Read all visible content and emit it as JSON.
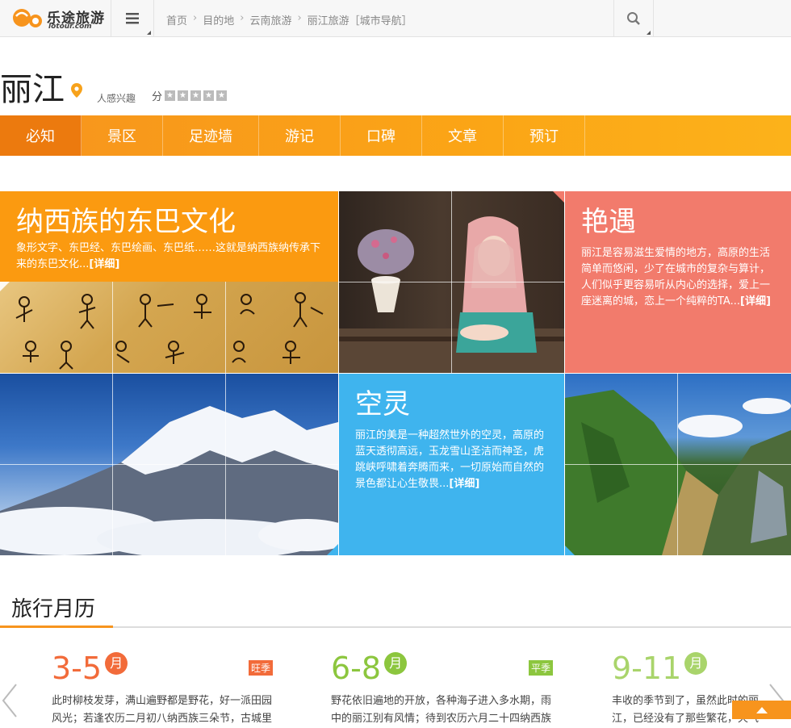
{
  "header": {
    "logo_text": "乐途旅游",
    "logo_sub": "lotour.com",
    "breadcrumb": [
      "首页",
      "目的地",
      "云南旅游",
      "丽江旅游［城市导航］"
    ]
  },
  "city": {
    "name": "丽江",
    "interest_label": "人感兴趣",
    "score_label": "分",
    "stars": 5
  },
  "nav": {
    "items": [
      "必知",
      "景区",
      "足迹墙",
      "游记",
      "口碑",
      "文章",
      "预订"
    ],
    "active_index": 0
  },
  "cards": {
    "naxi": {
      "title": "纳西族的东巴文化",
      "desc": "象形文字、东巴经、东巴绘画、东巴纸……这就是纳西族纳传承下来的东巴文化...",
      "more": "[详细]"
    },
    "romance": {
      "title": "艳遇",
      "desc": "丽江是容易滋生爱情的地方，高原的生活简单而悠闲，少了在城市的复杂与算计，人们似乎更容易听从内心的选择，爱上一座迷离的城，恋上一个纯粹的TA...",
      "more": "[详细]"
    },
    "ethereal": {
      "title": "空灵",
      "desc": "丽江的美是一种超然世外的空灵，高原的蓝天透彻高远，玉龙雪山圣洁而神圣，虎跳峡呼啸着奔腾而来，一切原始而自然的景色都让心生敬畏...",
      "more": "[详细]"
    }
  },
  "calendar": {
    "title": "旅行月历",
    "seasons": [
      {
        "range": "3-5",
        "month": "月",
        "tag": "旺季",
        "color": "#f26b3a",
        "tag_color": "#f26b3a",
        "text": "此时柳枝发芽，满山遍野都是野花，好一派田园风光；若逢农历二月初八纳西族三朵节，古城里会是家"
      },
      {
        "range": "6-8",
        "month": "月",
        "tag": "平季",
        "color": "#8cc63e",
        "tag_color": "#8cc63e",
        "text": "野花依旧遍地的开放，各种海子进入多水期，雨中的丽江别有风情；待到农历六月二十四纳西族的火把"
      },
      {
        "range": "9-11",
        "month": "月",
        "tag": "",
        "color": "#a9d46b",
        "tag_color": "#a9d46b",
        "text": "丰收的季节到了，虽然此时的丽江，已经没有了那些繁花，天气多晴好，是"
      }
    ]
  },
  "colors": {
    "accent": "#f7941d",
    "card_orange": "#fb9a10",
    "card_salmon": "#f27b6c",
    "card_blue": "#3fb4ee"
  }
}
